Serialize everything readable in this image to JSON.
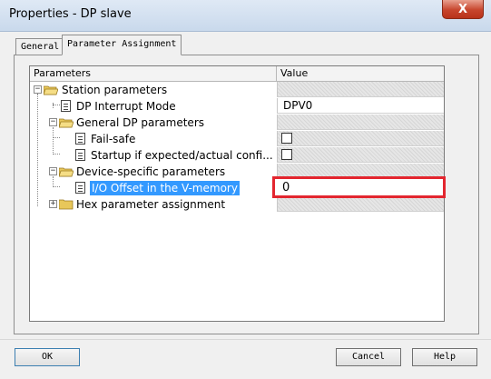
{
  "window": {
    "title": "Properties - DP slave",
    "close_glyph": "X"
  },
  "tabs": [
    {
      "label": "General",
      "active": false
    },
    {
      "label": "Parameter Assignment",
      "active": true
    }
  ],
  "grid": {
    "headers": {
      "parameters": "Parameters",
      "value": "Value"
    },
    "rows": [
      {
        "label": "Station parameters"
      },
      {
        "label": "DP Interrupt Mode",
        "value": "DPV0"
      },
      {
        "label": "General DP parameters"
      },
      {
        "label": "Fail-safe",
        "checked": false
      },
      {
        "label": "Startup if expected/actual confi...",
        "checked": false
      },
      {
        "label": "Device-specific parameters"
      },
      {
        "label": "I/O Offset in the V-memory",
        "value": "0"
      },
      {
        "label": "Hex parameter assignment"
      }
    ]
  },
  "buttons": {
    "ok": "OK",
    "cancel": "Cancel",
    "help": "Help"
  },
  "colors": {
    "selection": "#3399ff",
    "highlight_border": "#e3262f",
    "titlebar": "#c9d9ec"
  }
}
